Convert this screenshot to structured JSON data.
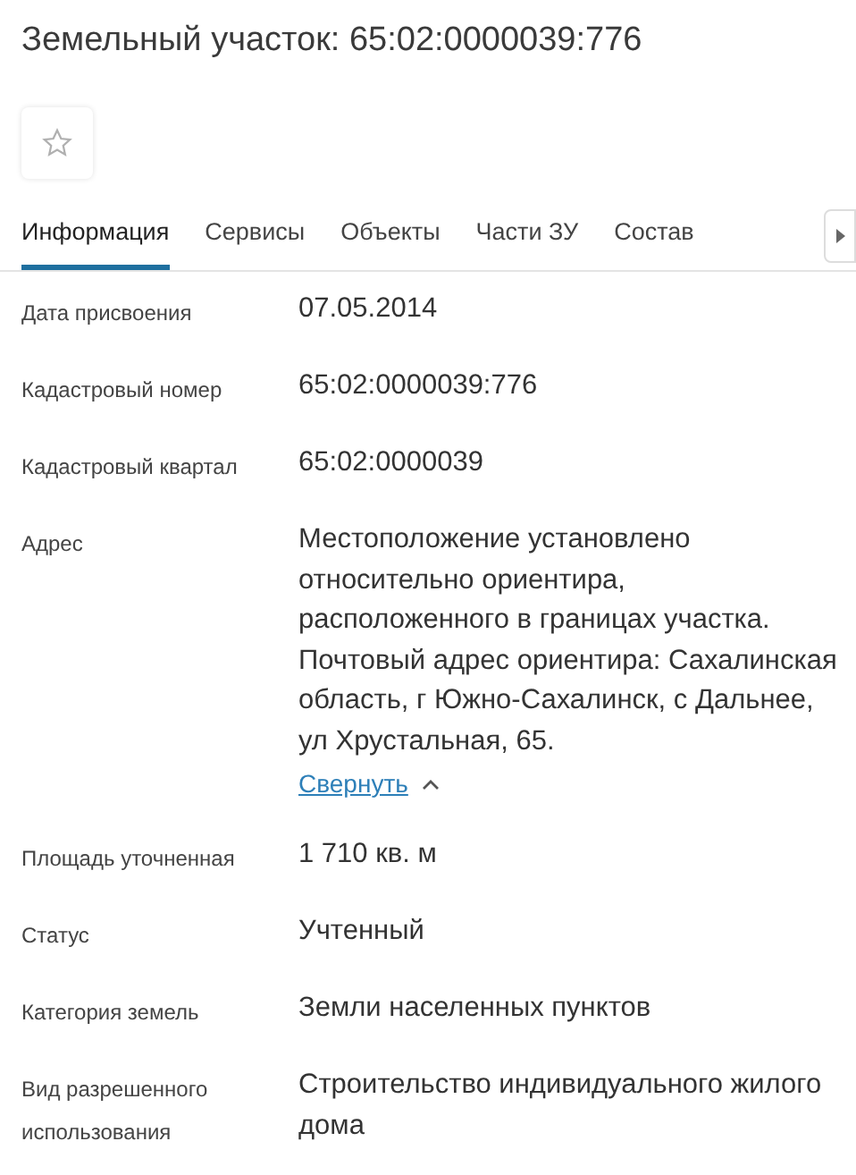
{
  "title": "Земельный участок: 65:02:0000039:776",
  "tabs": [
    {
      "label": "Информация",
      "selected": true
    },
    {
      "label": "Сервисы",
      "selected": false
    },
    {
      "label": "Объекты",
      "selected": false
    },
    {
      "label": "Части ЗУ",
      "selected": false
    },
    {
      "label": "Состав",
      "selected": false
    }
  ],
  "fields": [
    {
      "label": "Дата присвоения",
      "value": "07.05.2014"
    },
    {
      "label": "Кадастровый номер",
      "value": "65:02:0000039:776"
    },
    {
      "label": "Кадастровый квартал",
      "value": "65:02:0000039"
    },
    {
      "label": "Адрес",
      "value": "Местоположение установлено относительно ориентира, расположенного в границах участка. Почтовый адрес ориентира: Сахалинская область, г Южно-Сахалинск, с Дальнее, ул Хрустальная, 65.",
      "toggle": "Свернуть",
      "expanded": true
    },
    {
      "label": "Площадь уточненная",
      "value": "1 710 кв. м"
    },
    {
      "label": "Статус",
      "value": "Учтенный"
    },
    {
      "label": "Категория земель",
      "value": "Земли населенных пунктов"
    },
    {
      "label": "Вид разрешенного использования",
      "value": "Строительство индивидуального жилого дома"
    }
  ]
}
